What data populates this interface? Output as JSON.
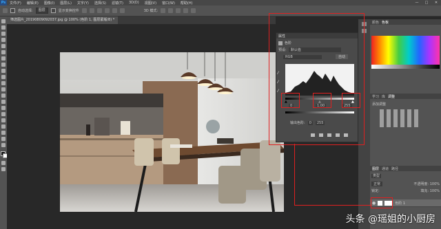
{
  "app": {
    "logo": "Ps"
  },
  "menu": {
    "items": [
      "文件(F)",
      "编辑(E)",
      "图像(I)",
      "图层(L)",
      "文字(Y)",
      "选择(S)",
      "滤镜(T)",
      "3D(D)",
      "视图(V)",
      "窗口(W)",
      "帮助(H)"
    ]
  },
  "window_controls": {
    "minimize": "—",
    "maximize": "□",
    "close": "✕"
  },
  "options": {
    "auto_select_label": "自动选择:",
    "auto_select_value": "图层",
    "show_transform_label": "显示变换控件",
    "mode_label": "3D 模式:"
  },
  "document": {
    "tab_title": "筛选图片_20190809092037.jpg @ 100% (色阶 1, 图层蒙版/8) *"
  },
  "properties": {
    "tab_label": "属性",
    "adjustment_name": "色阶",
    "preset_label": "预设:",
    "preset_value": "默认值",
    "channel_value": "RGB",
    "auto_label": "自动",
    "input_shadow": "0",
    "input_midtone": "1.00",
    "input_highlight": "255",
    "output_label": "输出色阶:",
    "output_min": "0",
    "output_max": "255"
  },
  "color_panel": {
    "tab1": "颜色",
    "tab2": "色板"
  },
  "adjust_panel": {
    "tab1": "学习",
    "tab2": "库",
    "tab3": "调整",
    "add_label": "添加调整"
  },
  "layers_panel": {
    "tab1": "图层",
    "tab2": "通道",
    "tab3": "路径",
    "filter_label": "类型",
    "blend_mode": "正常",
    "opacity_label": "不透明度:",
    "opacity": "100%",
    "lock_label": "锁定:",
    "fill_label": "填充:",
    "fill": "100%",
    "adjust_layer_name": "色阶 1"
  },
  "watermark": {
    "text": "头条 @瑶姐的小厨房"
  }
}
